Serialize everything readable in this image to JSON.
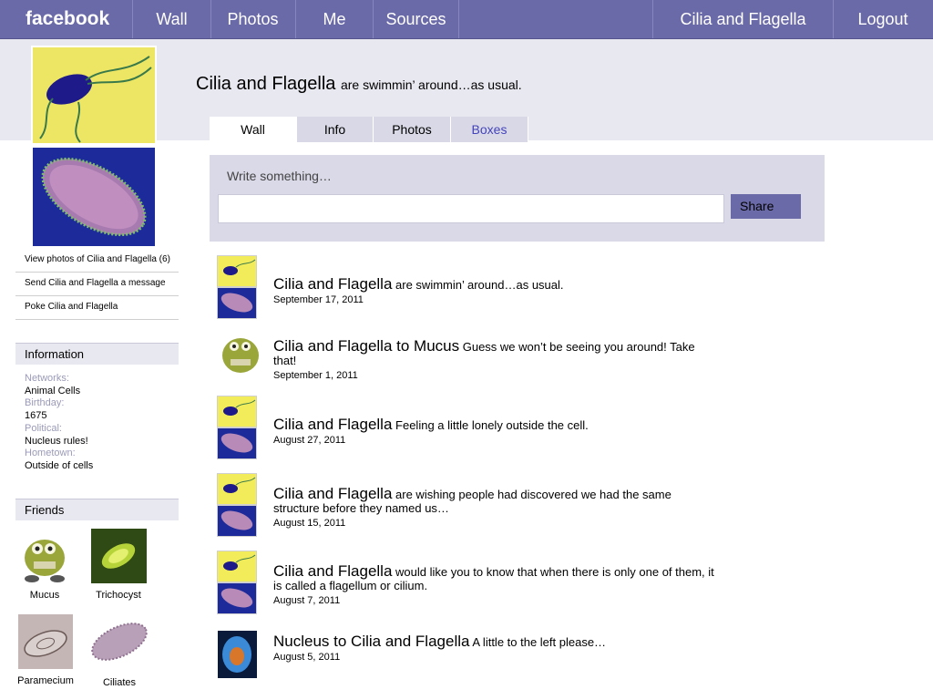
{
  "nav": {
    "logo": "facebook",
    "items": [
      "Wall",
      "Photos",
      "Me",
      "Sources"
    ],
    "profile_name": "Cilia and Flagella",
    "logout": "Logout"
  },
  "profile": {
    "name": "Cilia and Flagella",
    "status": "are swimmin’ around…as usual."
  },
  "tabs": [
    "Wall",
    "Info",
    "Photos",
    "Boxes"
  ],
  "composer": {
    "label": "Write something…",
    "share": "Share",
    "value": ""
  },
  "sidebar": {
    "links": [
      "View photos of Cilia and Flagella (6)",
      "Send Cilia and Flagella a message",
      "Poke Cilia and Flagella"
    ],
    "info_heading": "Information",
    "info": [
      {
        "label": "Networks:",
        "value": "Animal Cells"
      },
      {
        "label": "Birthday:",
        "value": "1675"
      },
      {
        "label": "Political:",
        "value": "Nucleus rules!"
      },
      {
        "label": "Hometown:",
        "value": "Outside of cells"
      }
    ],
    "friends_heading": "Friends",
    "friends": [
      "Mucus",
      "Trichocyst",
      "Paramecium",
      "Ciliates"
    ]
  },
  "posts": [
    {
      "who": "Cilia and Flagella",
      "text": "are swimmin’ around…as usual.",
      "date": "September 17, 2011"
    },
    {
      "who": "Cilia and Flagella to Mucus",
      "text": "Guess we won’t be seeing you around! Take that!",
      "date": "September 1, 2011"
    },
    {
      "who": "Cilia and Flagella",
      "text": "Feeling a little lonely outside the cell.",
      "date": "August 27, 2011"
    },
    {
      "who": "Cilia and Flagella",
      "text": "are wishing people had discovered we had the same structure before they named us…",
      "date": "August 15, 2011"
    },
    {
      "who": "Cilia and Flagella",
      "text": "would like you to know that when there is only one of them, it is called a flagellum or cilium.",
      "date": "August 7, 2011"
    },
    {
      "who": "Nucleus to Cilia and Flagella",
      "text": "A little to the left please…",
      "date": "August 5, 2011"
    }
  ],
  "colors": {
    "nav_bg": "#6b6aa8",
    "band_bg": "#e8e8f0",
    "composer_bg": "#d9d9e8"
  }
}
